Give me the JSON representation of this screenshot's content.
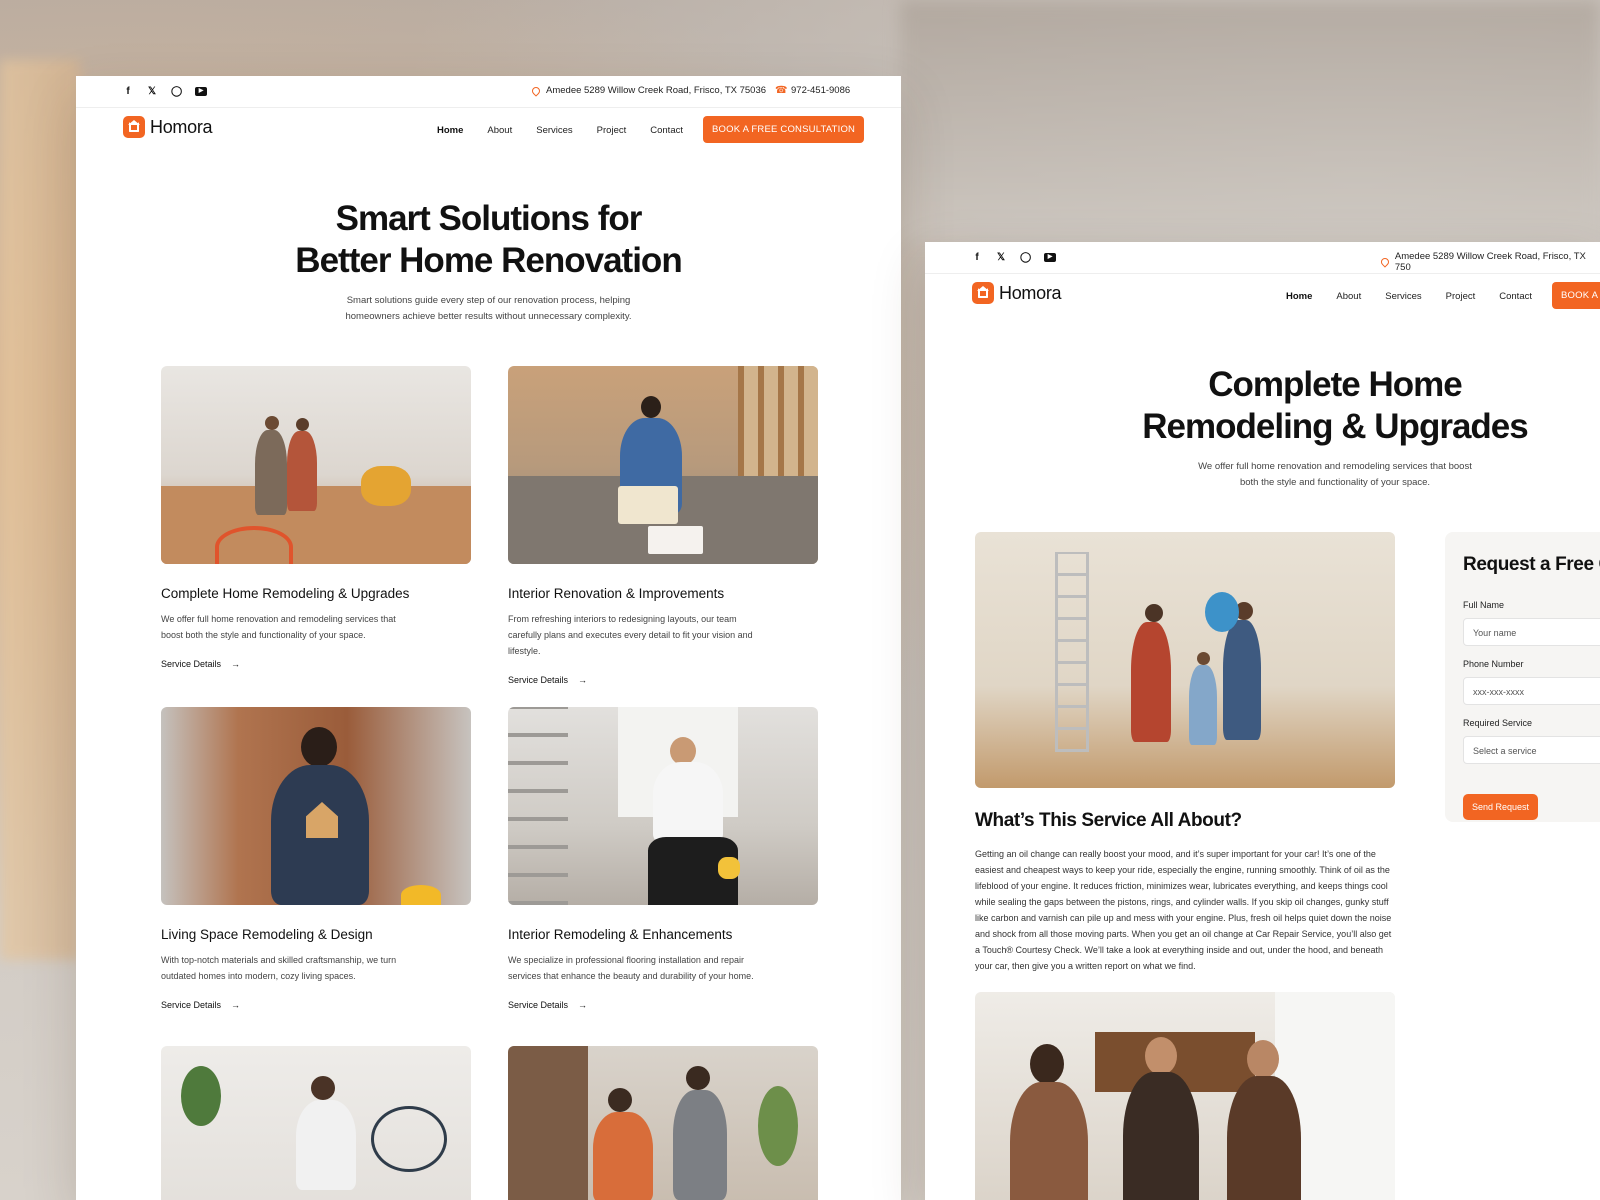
{
  "brand": {
    "name": "Homora",
    "accent": "#f26522"
  },
  "topbar": {
    "address": "Amedee 5289 Willow Creek Road, Frisco, TX 75036",
    "address_cut": "Amedee 5289 Willow Creek Road, Frisco, TX 750",
    "phone": "972-451-9086",
    "socials": [
      "facebook-icon",
      "twitter-icon",
      "instagram-icon",
      "youtube-icon"
    ]
  },
  "nav": {
    "items": [
      "Home",
      "About",
      "Services",
      "Project",
      "Contact"
    ],
    "cta": "BOOK A FREE CONSULTATION",
    "cta_cut": "BOOK A F"
  },
  "left_page": {
    "hero_title_1": "Smart Solutions for",
    "hero_title_2": "Better Home Renovation",
    "hero_sub_1": "Smart solutions guide every step of our renovation process, helping",
    "hero_sub_2": "homeowners achieve better results without unnecessary complexity.",
    "cards": [
      {
        "title": "Complete Home Remodeling & Upgrades",
        "desc": "We offer full home renovation and remodeling services that boost both the style and functionality of your space.",
        "link": "Service Details"
      },
      {
        "title": "Interior Renovation & Improvements",
        "desc": "From refreshing interiors to redesigning layouts, our team carefully plans and executes every detail to fit your vision and lifestyle.",
        "link": "Service Details"
      },
      {
        "title": "Living Space Remodeling & Design",
        "desc": "With top-notch materials and skilled craftsmanship, we turn outdated homes into modern, cozy living spaces.",
        "link": "Service Details"
      },
      {
        "title": "Interior Remodeling & Enhancements",
        "desc": "We specialize in professional flooring installation and repair services that enhance the beauty and durability of your home.",
        "link": "Service Details"
      }
    ]
  },
  "right_page": {
    "hero_title_1": "Complete Home",
    "hero_title_2": "Remodeling & Upgrades",
    "hero_sub_1": "We offer full home renovation and remodeling services that boost",
    "hero_sub_2": "both the style and functionality of your space.",
    "form": {
      "title": "Request a Free C",
      "name_label": "Full Name",
      "name_placeholder": "Your name",
      "phone_label": "Phone Number",
      "phone_placeholder": "xxx-xxx-xxxx",
      "service_label": "Required Service",
      "service_placeholder": "Select a service",
      "submit": "Send Request"
    },
    "about_title": "What’s This Service All About?",
    "about_text": "Getting an oil change can really boost your mood, and it’s super important for your car! It’s one of the easiest and cheapest ways to keep your ride, especially the engine, running smoothly. Think of oil as the lifeblood of your engine. It reduces friction, minimizes wear, lubricates everything, and keeps things cool while sealing the gaps between the pistons, rings, and cylinder walls. If you skip oil changes, gunky stuff like carbon and varnish can pile up and mess with your engine. Plus, fresh oil helps quiet down the noise and shock from all those moving parts. When you get an oil change at Car Repair Service, you’ll also get a Touch® Courtesy Check. We’ll take a look at everything inside and out, under the hood, and beneath your car, then give you a written report on what we find."
  }
}
